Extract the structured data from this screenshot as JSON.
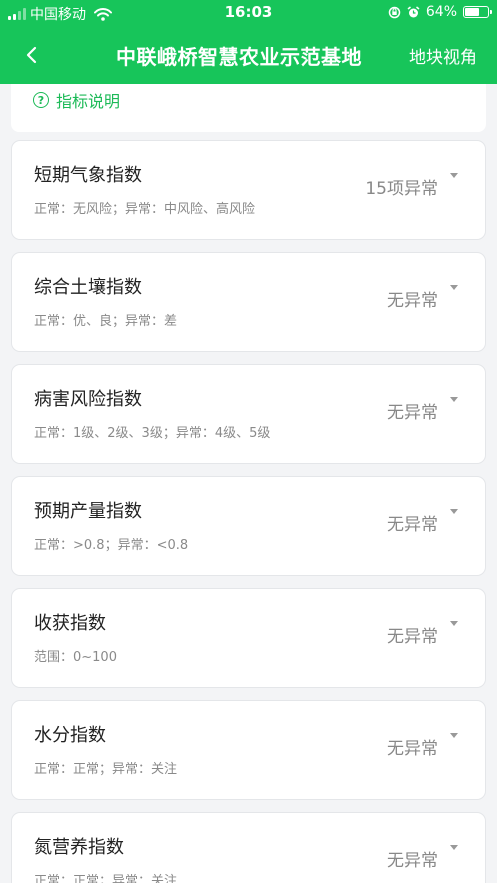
{
  "status_bar": {
    "carrier": "中国移动",
    "time": "16:03",
    "battery": "64%",
    "battery_level": 0.64
  },
  "nav": {
    "title": "中联峨桥智慧农业示范基地",
    "right_action": "地块视角"
  },
  "info": {
    "link_label": "指标说明",
    "icon_glyph": "?"
  },
  "cards": [
    {
      "title": "短期气象指数",
      "subtitle": "正常：无风险；异常：中风险、高风险",
      "status": "15项异常"
    },
    {
      "title": "综合土壤指数",
      "subtitle": "正常：优、良；异常：差",
      "status": "无异常"
    },
    {
      "title": "病害风险指数",
      "subtitle": "正常：1级、2级、3级；异常：4级、5级",
      "status": "无异常"
    },
    {
      "title": "预期产量指数",
      "subtitle": "正常：>0.8；异常：<0.8",
      "status": "无异常"
    },
    {
      "title": "收获指数",
      "subtitle": "范围：0~100",
      "status": "无异常"
    },
    {
      "title": "水分指数",
      "subtitle": "正常：正常；异常：关注",
      "status": "无异常"
    },
    {
      "title": "氮营养指数",
      "subtitle": "正常：正常；异常：关注",
      "status": "无异常"
    }
  ]
}
